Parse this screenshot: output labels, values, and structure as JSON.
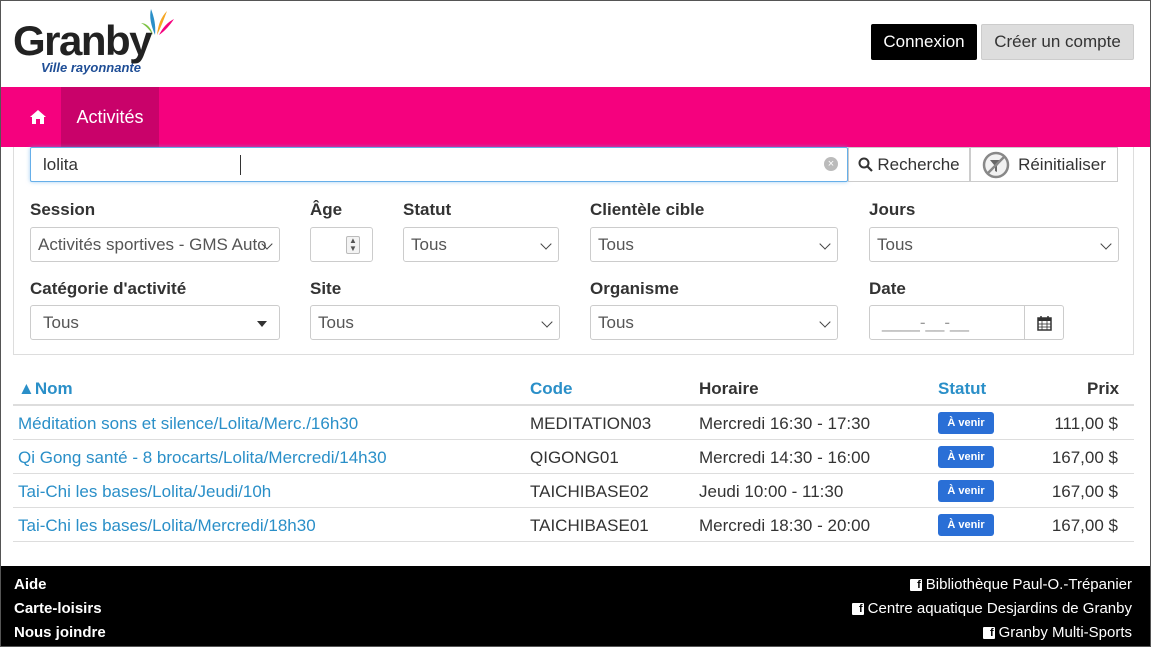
{
  "header": {
    "logo_word": "Granby",
    "logo_tagline": "Ville rayonnante",
    "login_label": "Connexion",
    "signup_label": "Créer un compte"
  },
  "nav": {
    "home_icon": "home-icon",
    "active_label": "Activités"
  },
  "search": {
    "value": "lolita",
    "search_label": "Recherche",
    "reset_label": "Réinitialiser"
  },
  "filters": {
    "session": {
      "label": "Session",
      "value": "Activités sportives - GMS Auto"
    },
    "age": {
      "label": "Âge",
      "value": ""
    },
    "statut": {
      "label": "Statut",
      "value": "Tous"
    },
    "clientele": {
      "label": "Clientèle cible",
      "value": "Tous"
    },
    "jours": {
      "label": "Jours",
      "value": "Tous"
    },
    "categorie": {
      "label": "Catégorie d'activité",
      "value": "Tous"
    },
    "site": {
      "label": "Site",
      "value": "Tous"
    },
    "organisme": {
      "label": "Organisme",
      "value": "Tous"
    },
    "date": {
      "label": "Date",
      "placeholder": "____-__-__"
    }
  },
  "table": {
    "headers": {
      "nom": "▲Nom",
      "code": "Code",
      "horaire": "Horaire",
      "statut": "Statut",
      "prix": "Prix"
    },
    "rows": [
      {
        "nom": "Méditation sons et silence/Lolita/Merc./16h30",
        "code": "MEDITATION03",
        "horaire": "Mercredi 16:30 - 17:30",
        "statut": "À venir",
        "prix": "111,00 $"
      },
      {
        "nom": "Qi Gong santé - 8 brocarts/Lolita/Mercredi/14h30",
        "code": "QIGONG01",
        "horaire": "Mercredi 14:30 - 16:00",
        "statut": "À venir",
        "prix": "167,00 $"
      },
      {
        "nom": "Tai-Chi les bases/Lolita/Jeudi/10h",
        "code": "TAICHIBASE02",
        "horaire": "Jeudi 10:00 - 11:30",
        "statut": "À venir",
        "prix": "167,00 $"
      },
      {
        "nom": "Tai-Chi les bases/Lolita/Mercredi/18h30",
        "code": "TAICHIBASE01",
        "horaire": "Mercredi 18:30 - 20:00",
        "statut": "À venir",
        "prix": "167,00 $"
      }
    ]
  },
  "footer": {
    "links": [
      "Aide",
      "Carte-loisirs",
      "Nous joindre"
    ],
    "social": [
      "Bibliothèque Paul-O.-Trépanier",
      "Centre aquatique Desjardins de Granby",
      "Granby Multi-Sports"
    ],
    "fb_glyph": "f"
  },
  "colors": {
    "brand_pink": "#f5017e",
    "nav_active": "#c9026a",
    "link_blue": "#2a8fc8",
    "badge_blue": "#2a6fd6"
  }
}
